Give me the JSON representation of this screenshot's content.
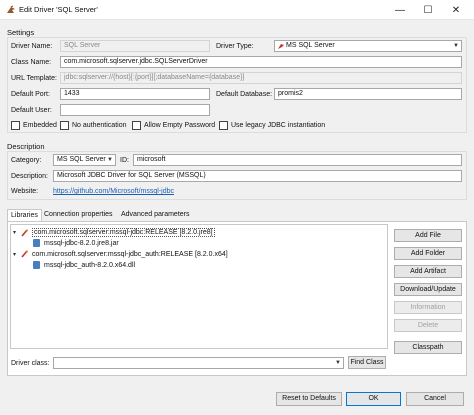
{
  "window": {
    "title": "Edit Driver 'SQL Server'",
    "minimize_glyph": "—",
    "maximize_glyph": "☐",
    "close_glyph": "✕"
  },
  "settings": {
    "section_label": "Settings",
    "driver_name_label": "Driver Name:",
    "driver_name_value": "SQL Server",
    "driver_type_label": "Driver Type:",
    "driver_type_value": "MS SQL Server",
    "class_name_label": "Class Name:",
    "class_name_value": "com.microsoft.sqlserver.jdbc.SQLServerDriver",
    "url_template_label": "URL Template:",
    "url_template_value": "jdbc:sqlserver://{host}[:{port}][;databaseName={database}]",
    "default_port_label": "Default Port:",
    "default_port_value": "1433",
    "default_database_label": "Default Database:",
    "default_database_value": "promis2",
    "default_user_label": "Default User:",
    "default_user_value": "",
    "checkboxes": [
      {
        "label": "Embedded",
        "checked": false
      },
      {
        "label": "No authentication",
        "checked": false
      },
      {
        "label": "Allow Empty Password",
        "checked": false
      },
      {
        "label": "Use legacy JDBC instantiation",
        "checked": false
      }
    ]
  },
  "description": {
    "section_label": "Description",
    "category_label": "Category:",
    "category_value": "MS SQL Server",
    "id_label": "ID:",
    "id_value": "microsoft",
    "description_label": "Description:",
    "description_value": "Microsoft JDBC Driver for SQL Server (MSSQL)",
    "website_label": "Website:",
    "website_value": "https://github.com/Microsoft/mssql-jdbc"
  },
  "tabs": [
    {
      "label": "Libraries",
      "active": true
    },
    {
      "label": "Connection properties",
      "active": false
    },
    {
      "label": "Advanced parameters",
      "active": false
    }
  ],
  "libraries": [
    {
      "name": "com.microsoft.sqlserver:mssql-jdbc:RELEASE [8.2.0.jre8]",
      "selected": true,
      "children": [
        "mssql-jdbc-8.2.0.jre8.jar"
      ]
    },
    {
      "name": "com.microsoft.sqlserver:mssql-jdbc_auth:RELEASE [8.2.0.x64]",
      "selected": false,
      "children": [
        "mssql-jdbc_auth-8.2.0.x64.dll"
      ]
    }
  ],
  "library_buttons": {
    "add_file": "Add File",
    "add_folder": "Add Folder",
    "add_artifact": "Add Artifact",
    "download_update": "Download/Update",
    "information": "Information",
    "delete": "Delete",
    "classpath": "Classpath"
  },
  "driver_class": {
    "label": "Driver class:",
    "value": "",
    "find_class": "Find Class"
  },
  "footer": {
    "reset": "Reset to Defaults",
    "ok": "OK",
    "cancel": "Cancel"
  },
  "colors": {
    "accent": "#0078d7",
    "link": "#1a5fb4"
  }
}
